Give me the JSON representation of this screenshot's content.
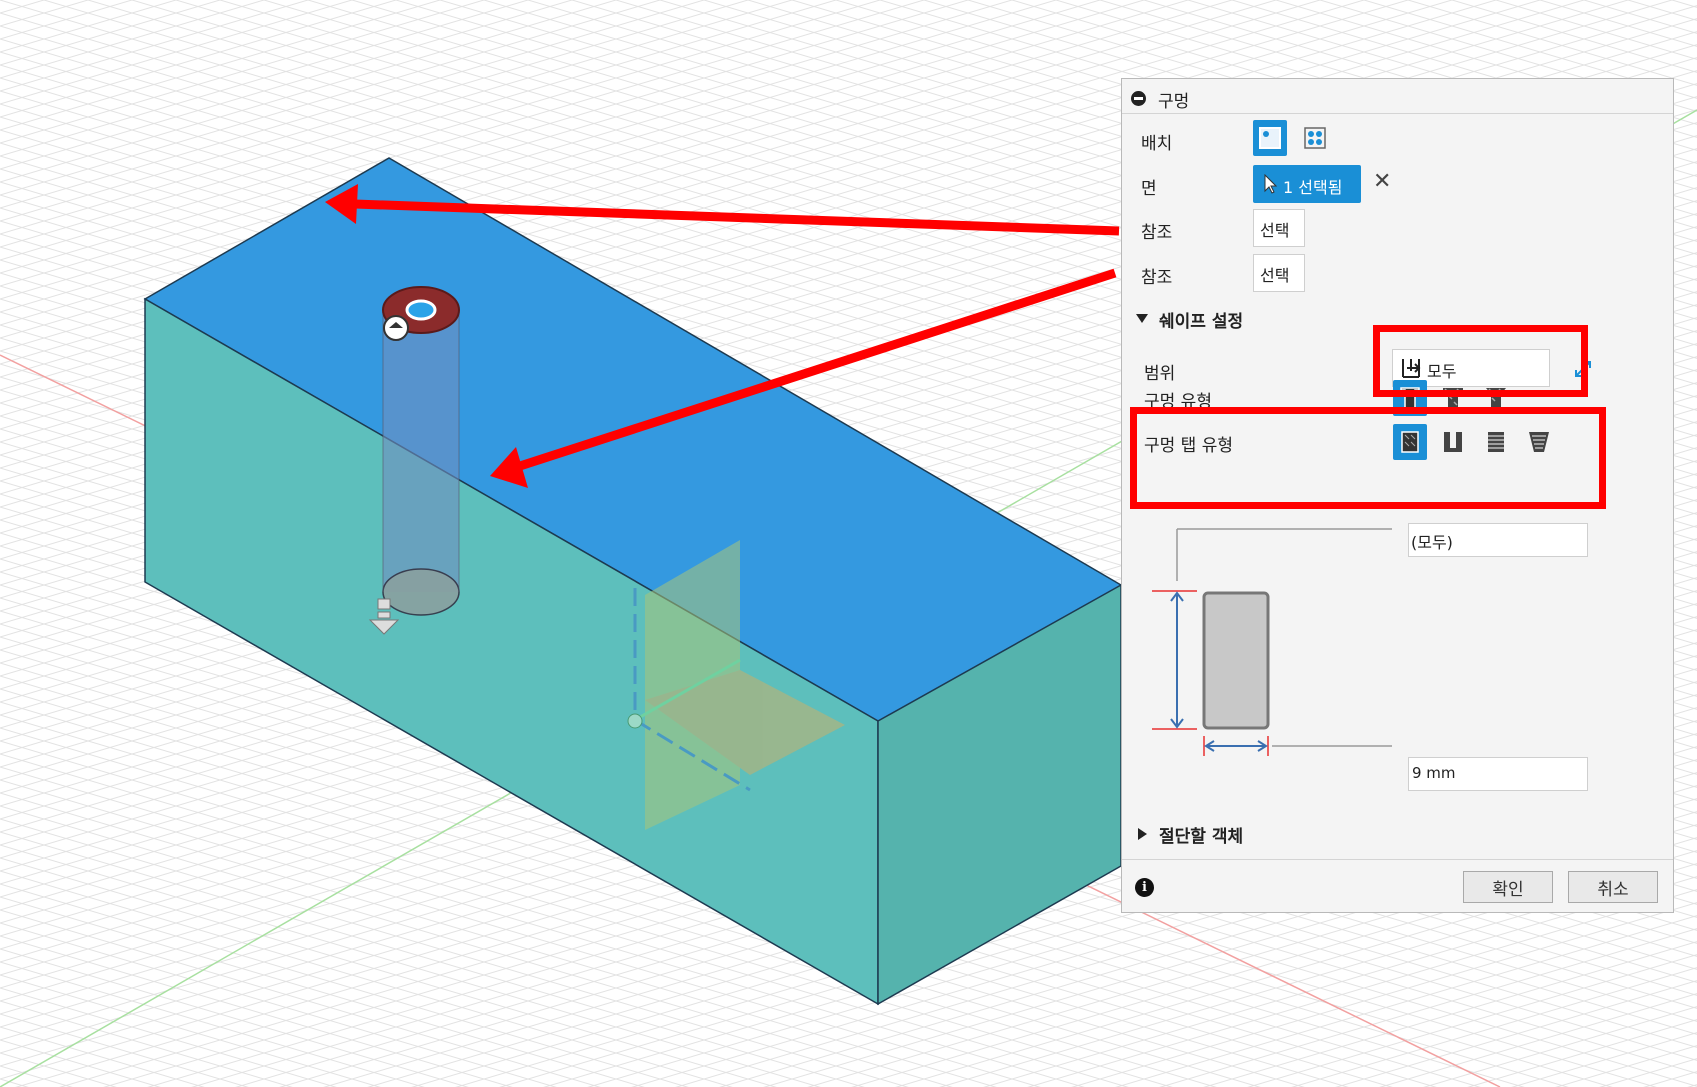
{
  "dialog": {
    "title": "구멍",
    "rows": {
      "placement_label": "배치",
      "face_label": "면",
      "face_selected": "1 선택됨",
      "reference1_label": "참조",
      "reference1_value": "선택",
      "reference2_label": "참조",
      "reference2_value": "선택"
    },
    "shape_section": "쉐이프 설정",
    "extent_label": "범위",
    "extent_value": "모두",
    "hole_type_label": "구멍 유형",
    "tap_type_label": "구멍 탭 유형",
    "preview": {
      "depth_value": "(모두)",
      "diameter_value": "9 mm"
    },
    "objects_section": "절단할 객체",
    "ok_button": "확인",
    "cancel_button": "취소"
  },
  "colors": {
    "top_face": "#3499e0",
    "side_face": "#5dbfbc",
    "end_face": "#55b3ad",
    "accent": "#1a8fd6",
    "annotation": "#ff0000"
  },
  "icons": [
    "minus-circle-icon",
    "face-placement-icon",
    "pattern-placement-icon",
    "cursor-icon",
    "close-icon",
    "extent-all-icon",
    "flip-icon",
    "simple-hole-icon",
    "counterbore-icon",
    "countersink-icon",
    "simple-tap-icon",
    "clearance-tap-icon",
    "tapped-icon",
    "taper-tap-icon",
    "info-icon",
    "triangle-down-icon",
    "triangle-right-icon"
  ]
}
